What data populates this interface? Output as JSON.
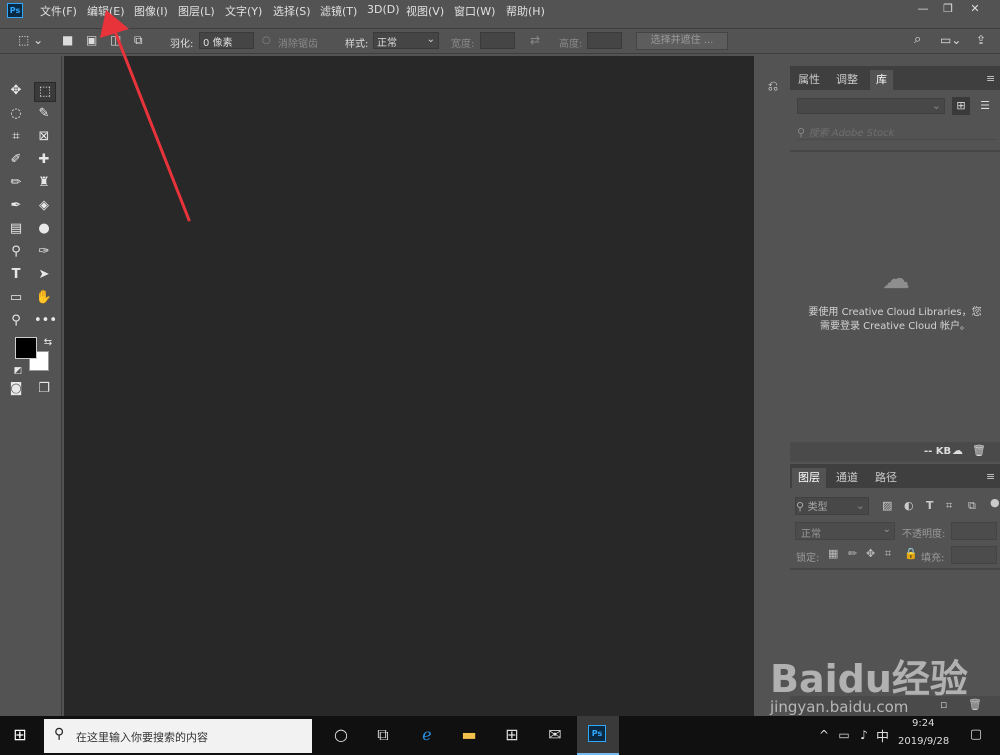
{
  "app": {
    "logo": "Ps"
  },
  "menu": [
    "文件(F)",
    "编辑(E)",
    "图像(I)",
    "图层(L)",
    "文字(Y)",
    "选择(S)",
    "滤镜(T)",
    "3D(D)",
    "视图(V)",
    "窗口(W)",
    "帮助(H)"
  ],
  "window_controls": {
    "minimize": "—",
    "restore": "❐",
    "close": "✕"
  },
  "options": {
    "feather_label": "羽化:",
    "feather_value": "0 像素",
    "antialias_label": "消除锯齿",
    "style_label": "样式:",
    "style_value": "正常",
    "width_label": "宽度:",
    "height_label": "高度:",
    "select_mask_label": "选择并遮住 ..."
  },
  "panel_top": {
    "tabs": [
      "属性",
      "调整",
      "库"
    ],
    "active_tab": "库",
    "search_placeholder": "搜索 Adobe Stock",
    "message_line1": "要使用 Creative Cloud Libraries，您",
    "message_line2": "需要登录 Creative Cloud 帐户。",
    "storage": "-- KB"
  },
  "panel_layers": {
    "tabs": [
      "图层",
      "通道",
      "路径"
    ],
    "active_tab": "图层",
    "filter_label": "类型",
    "blend_mode": "正常",
    "opacity_label": "不透明度:",
    "lock_label": "锁定:",
    "fill_label": "填充:"
  },
  "taskbar": {
    "search_placeholder": "在这里输入你要搜索的内容",
    "ime": "中",
    "time": "9:24",
    "date": "2019/9/28"
  },
  "watermark": {
    "brand": "Baidu经验",
    "url": "jingyan.baidu.com"
  },
  "colors": {
    "accent": "#31a8ff",
    "arrow": "#e8333a",
    "canvas": "#282828",
    "panel": "#535353"
  }
}
